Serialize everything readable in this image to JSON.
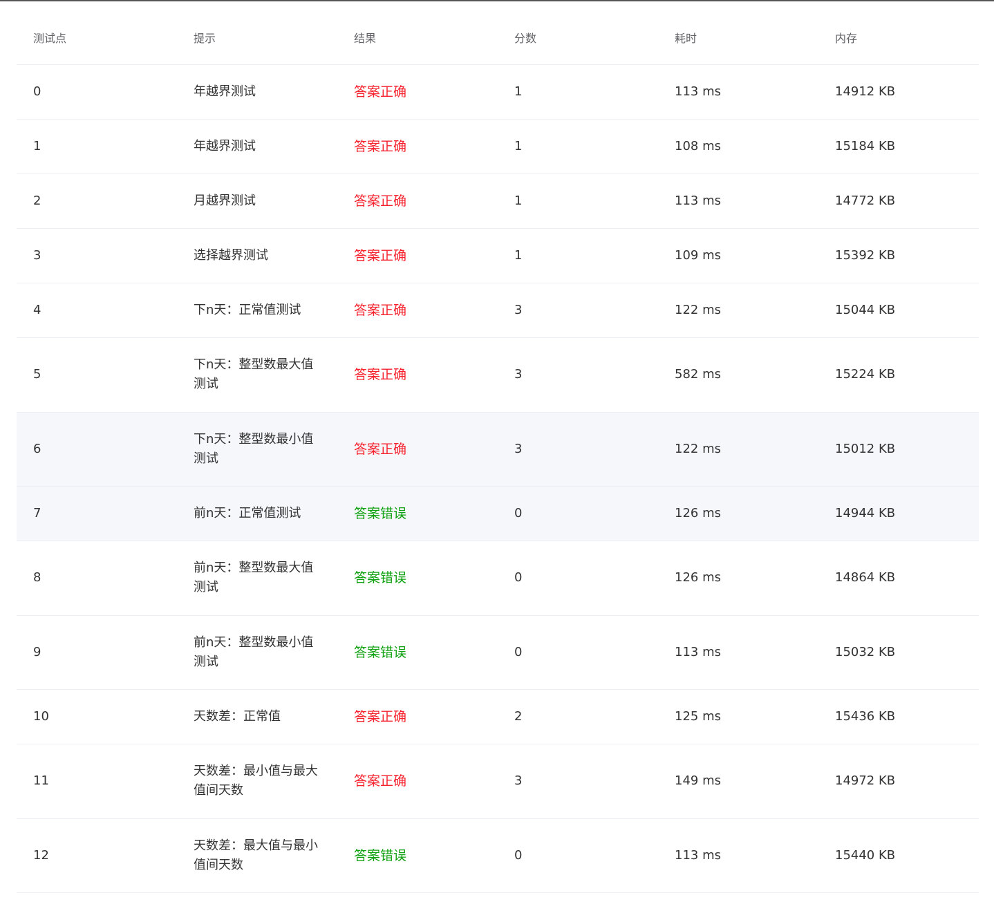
{
  "table": {
    "headers": {
      "id": "测试点",
      "hint": "提示",
      "result": "结果",
      "score": "分数",
      "time": "耗时",
      "memory": "内存"
    },
    "rows": [
      {
        "id": "0",
        "hint": "年越界测试",
        "result": "答案正确",
        "score": "1",
        "time": "113 ms",
        "memory": "14912 KB"
      },
      {
        "id": "1",
        "hint": "年越界测试",
        "result": "答案正确",
        "score": "1",
        "time": "108 ms",
        "memory": "15184 KB"
      },
      {
        "id": "2",
        "hint": "月越界测试",
        "result": "答案正确",
        "score": "1",
        "time": "113 ms",
        "memory": "14772 KB"
      },
      {
        "id": "3",
        "hint": "选择越界测试",
        "result": "答案正确",
        "score": "1",
        "time": "109 ms",
        "memory": "15392 KB"
      },
      {
        "id": "4",
        "hint": "下n天：正常值测试",
        "result": "答案正确",
        "score": "3",
        "time": "122 ms",
        "memory": "15044 KB"
      },
      {
        "id": "5",
        "hint": "下n天：整型数最大值测试",
        "result": "答案正确",
        "score": "3",
        "time": "582 ms",
        "memory": "15224 KB"
      },
      {
        "id": "6",
        "hint": "下n天：整型数最小值测试",
        "result": "答案正确",
        "score": "3",
        "time": "122 ms",
        "memory": "15012 KB"
      },
      {
        "id": "7",
        "hint": "前n天：正常值测试",
        "result": "答案错误",
        "score": "0",
        "time": "126 ms",
        "memory": "14944 KB"
      },
      {
        "id": "8",
        "hint": "前n天：整型数最大值测试",
        "result": "答案错误",
        "score": "0",
        "time": "126 ms",
        "memory": "14864 KB"
      },
      {
        "id": "9",
        "hint": "前n天：整型数最小值测试",
        "result": "答案错误",
        "score": "0",
        "time": "113 ms",
        "memory": "15032 KB"
      },
      {
        "id": "10",
        "hint": "天数差：正常值",
        "result": "答案正确",
        "score": "2",
        "time": "125 ms",
        "memory": "15436 KB"
      },
      {
        "id": "11",
        "hint": "天数差：最小值与最大值间天数",
        "result": "答案正确",
        "score": "3",
        "time": "149 ms",
        "memory": "14972 KB"
      },
      {
        "id": "12",
        "hint": "天数差：最大值与最小值间天数",
        "result": "答案错误",
        "score": "0",
        "time": "113 ms",
        "memory": "15440 KB"
      }
    ]
  },
  "colors": {
    "correct": "#f5222d",
    "wrong": "#0fa10f",
    "hover_row": "#f5f7fa"
  }
}
